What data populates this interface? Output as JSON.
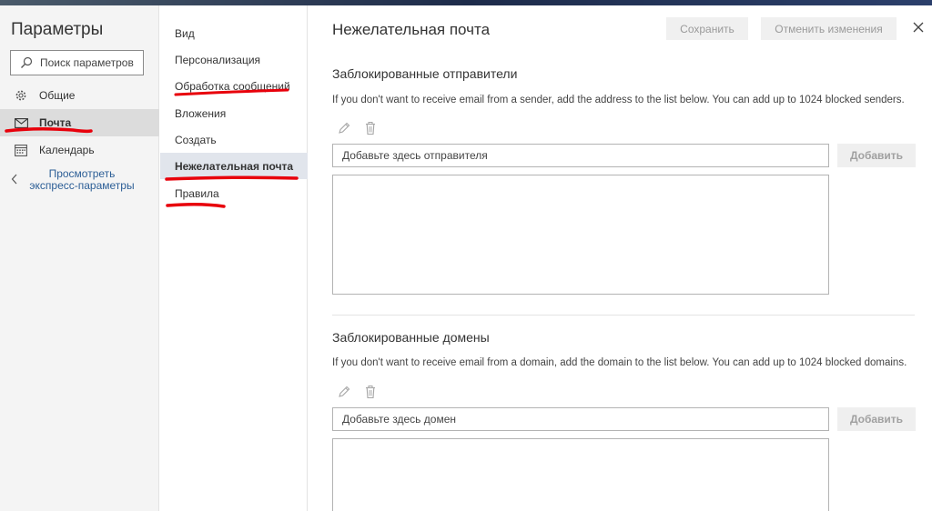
{
  "left": {
    "title": "Параметры",
    "search_placeholder": "Поиск параметров",
    "items": [
      {
        "label": "Общие"
      },
      {
        "label": "Почта"
      },
      {
        "label": "Календарь"
      }
    ],
    "back_label_line1": "Просмотреть",
    "back_label_line2": "экспресс-параметры"
  },
  "middle": {
    "items": [
      {
        "label": "Вид"
      },
      {
        "label": "Персонализация"
      },
      {
        "label": "Обработка сообщений"
      },
      {
        "label": "Вложения"
      },
      {
        "label": "Создать"
      },
      {
        "label": "Нежелательная почта"
      },
      {
        "label": "Правила"
      }
    ]
  },
  "main": {
    "title": "Нежелательная почта",
    "save_label": "Сохранить",
    "cancel_label": "Отменить изменения",
    "blocked_senders": {
      "title": "Заблокированные отправители",
      "description": "If you don't want to receive email from a sender, add the address to the list below. You can add up to 1024 blocked senders.",
      "input_placeholder": "Добавьте здесь отправителя",
      "add_label": "Добавить"
    },
    "blocked_domains": {
      "title": "Заблокированные домены",
      "description": "If you don't want to receive email from a domain, add the domain to the list below. You can add up to 1024 blocked domains.",
      "input_placeholder": "Добавьте здесь домен",
      "add_label": "Добавить"
    }
  },
  "icons": {
    "search": "search-icon",
    "general": "gear-icon",
    "mail": "mail-icon",
    "calendar": "calendar-icon",
    "back": "chevron-left-icon",
    "edit": "pencil-icon",
    "delete": "trash-icon",
    "close": "close-icon"
  },
  "colors": {
    "annotation": "#e8000b",
    "link": "#2c5e96",
    "selected_left": "#dcdcdc",
    "selected_mid": "#e1e5ec"
  }
}
